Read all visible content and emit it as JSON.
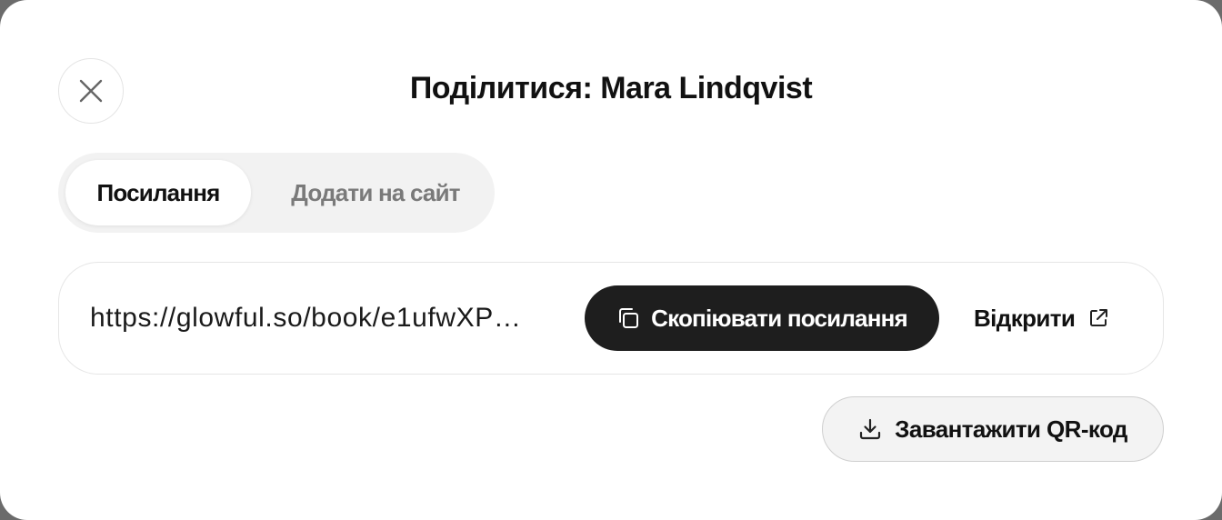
{
  "dialog": {
    "title": "Поділитися: Mara Lindqvist",
    "close_icon": "close-icon"
  },
  "tabs": [
    {
      "label": "Посилання",
      "active": true
    },
    {
      "label": "Додати на сайт",
      "active": false
    }
  ],
  "link": {
    "url": "https://glowful.so/book/e1ufwXP…",
    "copy_label": "Скопіювати посилання",
    "copy_icon": "copy-icon",
    "open_label": "Відкрити",
    "open_icon": "external-link-icon"
  },
  "qr": {
    "label": "Завантажити QR-код",
    "icon": "download-icon"
  },
  "colors": {
    "primary_button": "#1e1e1e",
    "tab_track": "#f2f2f2",
    "muted_text": "#7a7a7a"
  }
}
